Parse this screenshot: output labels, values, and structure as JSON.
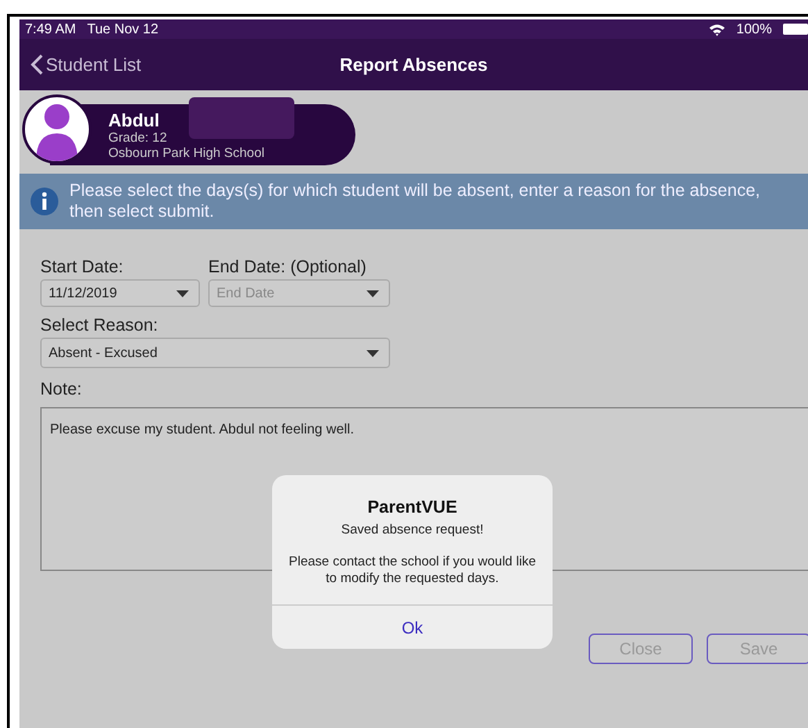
{
  "status_bar": {
    "time": "7:49 AM",
    "date": "Tue Nov 12",
    "battery": "100%"
  },
  "nav": {
    "back": "Student List",
    "title": "Report Absences"
  },
  "student": {
    "name": "Abdul",
    "grade": "Grade: 12",
    "school": "Osbourn Park High School"
  },
  "info_banner": "Please select the days(s) for which student will be absent, enter a reason for the absence, then select submit.",
  "form": {
    "start_date": {
      "label": "Start Date:",
      "value": "11/12/2019"
    },
    "end_date": {
      "label": "End Date: (Optional)",
      "placeholder": "End Date"
    },
    "reason": {
      "label": "Select Reason:",
      "value": "Absent - Excused"
    },
    "note": {
      "label": "Note:",
      "value": "Please excuse my student. Abdul not feeling well."
    }
  },
  "buttons": [
    "Close",
    "Save"
  ],
  "dialog": {
    "title": "ParentVUE",
    "message": "Saved absence request!",
    "detail": "Please contact the school if you would like to modify the requested days.",
    "button": "Ok"
  }
}
